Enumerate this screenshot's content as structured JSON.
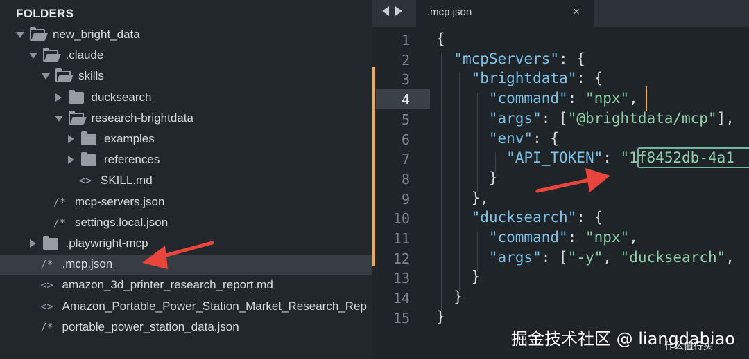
{
  "sidebar": {
    "title": "FOLDERS",
    "items": [
      {
        "label": "new_bright_data",
        "type": "folder",
        "expanded": true
      },
      {
        "label": ".claude",
        "type": "folder",
        "expanded": true
      },
      {
        "label": "skills",
        "type": "folder",
        "expanded": true
      },
      {
        "label": "ducksearch",
        "type": "folder",
        "expanded": false
      },
      {
        "label": "research-brightdata",
        "type": "folder",
        "expanded": true
      },
      {
        "label": "examples",
        "type": "folder",
        "expanded": false
      },
      {
        "label": "references",
        "type": "folder",
        "expanded": false
      },
      {
        "label": "SKILL.md",
        "type": "file",
        "glyph": "<>"
      },
      {
        "label": "mcp-servers.json",
        "type": "file",
        "glyph": "/*"
      },
      {
        "label": "settings.local.json",
        "type": "file",
        "glyph": "/*"
      },
      {
        "label": ".playwright-mcp",
        "type": "folder",
        "expanded": false
      },
      {
        "label": ".mcp.json",
        "type": "file",
        "glyph": "/*",
        "selected": true
      },
      {
        "label": "amazon_3d_printer_research_report.md",
        "type": "file",
        "glyph": "<>"
      },
      {
        "label": "Amazon_Portable_Power_Station_Market_Research_Rep",
        "type": "file",
        "glyph": "<>"
      },
      {
        "label": "portable_power_station_data.json",
        "type": "file",
        "glyph": "/*"
      }
    ]
  },
  "editor": {
    "tab_title": ".mcp.json",
    "tab_close": "×",
    "active_line": 4,
    "line_numbers": [
      "1",
      "2",
      "3",
      "4",
      "5",
      "6",
      "7",
      "8",
      "9",
      "10",
      "11",
      "12",
      "13",
      "14",
      "15"
    ],
    "lines": [
      [
        {
          "t": "{",
          "c": "punc"
        }
      ],
      [
        {
          "t": "  ",
          "c": "punc"
        },
        {
          "t": "\"mcpServers\"",
          "c": "key"
        },
        {
          "t": ": {",
          "c": "punc"
        }
      ],
      [
        {
          "t": "    ",
          "c": "punc"
        },
        {
          "t": "\"brightdata\"",
          "c": "key"
        },
        {
          "t": ": {",
          "c": "punc"
        }
      ],
      [
        {
          "t": "      ",
          "c": "punc"
        },
        {
          "t": "\"command\"",
          "c": "key"
        },
        {
          "t": ": ",
          "c": "punc"
        },
        {
          "t": "\"npx\"",
          "c": "str"
        },
        {
          "t": ",",
          "c": "punc"
        }
      ],
      [
        {
          "t": "      ",
          "c": "punc"
        },
        {
          "t": "\"args\"",
          "c": "key"
        },
        {
          "t": ": [",
          "c": "punc"
        },
        {
          "t": "\"@brightdata/mcp\"",
          "c": "str"
        },
        {
          "t": "],",
          "c": "punc"
        }
      ],
      [
        {
          "t": "      ",
          "c": "punc"
        },
        {
          "t": "\"env\"",
          "c": "key"
        },
        {
          "t": ": {",
          "c": "punc"
        }
      ],
      [
        {
          "t": "        ",
          "c": "punc"
        },
        {
          "t": "\"API_TOKEN\"",
          "c": "key"
        },
        {
          "t": ": ",
          "c": "punc"
        },
        {
          "t": "\"1f8452db-4a1",
          "c": "str"
        }
      ],
      [
        {
          "t": "      ",
          "c": "punc"
        },
        {
          "t": "}",
          "c": "punc"
        }
      ],
      [
        {
          "t": "    ",
          "c": "punc"
        },
        {
          "t": "},",
          "c": "punc"
        }
      ],
      [
        {
          "t": "    ",
          "c": "punc"
        },
        {
          "t": "\"ducksearch\"",
          "c": "key"
        },
        {
          "t": ": {",
          "c": "punc"
        }
      ],
      [
        {
          "t": "      ",
          "c": "punc"
        },
        {
          "t": "\"command\"",
          "c": "key"
        },
        {
          "t": ": ",
          "c": "punc"
        },
        {
          "t": "\"npx\"",
          "c": "str"
        },
        {
          "t": ",",
          "c": "punc"
        }
      ],
      [
        {
          "t": "      ",
          "c": "punc"
        },
        {
          "t": "\"args\"",
          "c": "key"
        },
        {
          "t": ": [",
          "c": "punc"
        },
        {
          "t": "\"-y\"",
          "c": "str"
        },
        {
          "t": ", ",
          "c": "punc"
        },
        {
          "t": "\"ducksearch\"",
          "c": "str"
        },
        {
          "t": ",",
          "c": "punc"
        }
      ],
      [
        {
          "t": "    ",
          "c": "punc"
        },
        {
          "t": "}",
          "c": "punc"
        }
      ],
      [
        {
          "t": "  ",
          "c": "punc"
        },
        {
          "t": "}",
          "c": "punc"
        }
      ],
      [
        {
          "t": "}",
          "c": "punc"
        }
      ]
    ]
  },
  "watermark": {
    "text": "掘金技术社区 @ liangdabiao",
    "secondary": "什么值得买"
  },
  "colors": {
    "sidebar_bg": "#22272b",
    "editor_bg": "#1f2428",
    "key": "#7dc3e8",
    "string": "#8fd0a8",
    "modified_marker": "#f2a94a",
    "annotation_arrow": "#e8453c"
  },
  "icons": {
    "folder_open": "folder-open-icon",
    "folder_closed": "folder-icon",
    "file_code": "code-file-icon",
    "file_json": "json-file-icon"
  }
}
